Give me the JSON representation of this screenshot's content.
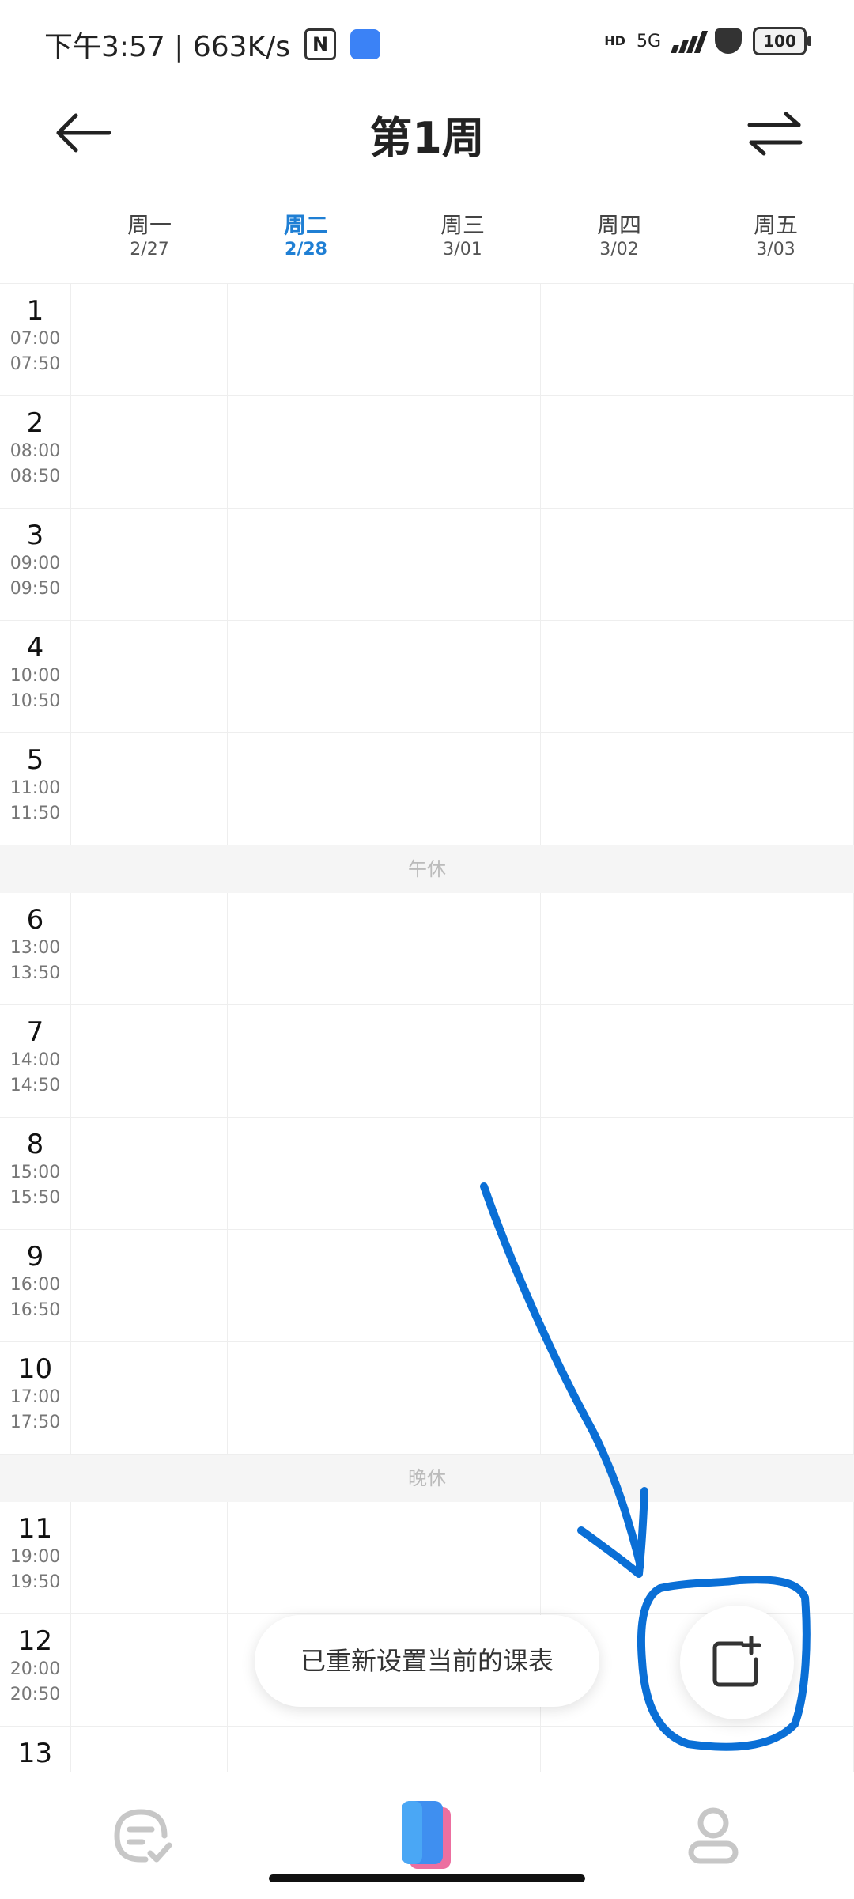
{
  "status_bar": {
    "time_speed": "下午3:57 | 663K/s",
    "nfc_label": "N",
    "hd_label": "HD",
    "network": "5G",
    "battery": "100"
  },
  "header": {
    "title": "第1周",
    "back_icon": "arrow-left-icon",
    "swap_icon": "swap-arrows-icon"
  },
  "days": [
    {
      "name": "周一",
      "date": "2/27"
    },
    {
      "name": "周二",
      "date": "2/28"
    },
    {
      "name": "周三",
      "date": "3/01"
    },
    {
      "name": "周四",
      "date": "3/02"
    },
    {
      "name": "周五",
      "date": "3/03"
    }
  ],
  "today_index": 1,
  "periods": [
    {
      "num": "1",
      "start": "07:00",
      "end": "07:50"
    },
    {
      "num": "2",
      "start": "08:00",
      "end": "08:50"
    },
    {
      "num": "3",
      "start": "09:00",
      "end": "09:50"
    },
    {
      "num": "4",
      "start": "10:00",
      "end": "10:50"
    },
    {
      "num": "5",
      "start": "11:00",
      "end": "11:50"
    },
    {
      "break": "午休"
    },
    {
      "num": "6",
      "start": "13:00",
      "end": "13:50"
    },
    {
      "num": "7",
      "start": "14:00",
      "end": "14:50"
    },
    {
      "num": "8",
      "start": "15:00",
      "end": "15:50"
    },
    {
      "num": "9",
      "start": "16:00",
      "end": "16:50"
    },
    {
      "num": "10",
      "start": "17:00",
      "end": "17:50"
    },
    {
      "break": "晚休"
    },
    {
      "num": "11",
      "start": "19:00",
      "end": "19:50"
    },
    {
      "num": "12",
      "start": "20:00",
      "end": "20:50"
    },
    {
      "num": "13",
      "start": "",
      "end": ""
    }
  ],
  "toast": "已重新设置当前的课表",
  "fab_icon": "add-course-icon",
  "bottom_nav": {
    "tasks_icon": "tasks-icon",
    "schedule_icon": "schedule-icon",
    "profile_icon": "profile-icon"
  },
  "colors": {
    "accent": "#1f7fd4",
    "annotation": "#0a6fd6"
  }
}
